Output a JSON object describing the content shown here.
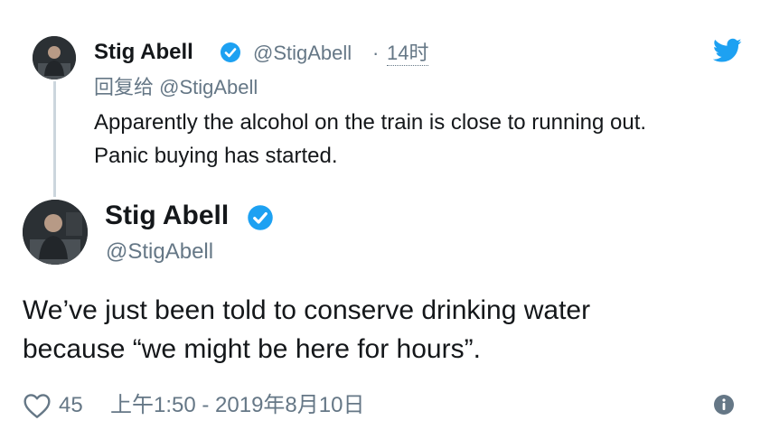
{
  "parent_tweet": {
    "name": "Stig Abell",
    "handle": "@StigAbell",
    "separator": "·",
    "time": "14时",
    "reply_to_prefix": "回复给",
    "reply_to_handle": "@StigAbell",
    "text_line1": "Apparently the alcohol on the train is close to running out.",
    "text_line2": "Panic buying has started."
  },
  "main_tweet": {
    "name": "Stig Abell",
    "handle": "@StigAbell",
    "text_line1": "We’ve just been told to conserve drinking water",
    "text_line2": "because “we might be here for hours”.",
    "likes": "45",
    "timestamp": "上午1:50 - 2019年8月10日"
  },
  "icons": {
    "brand": "twitter-bird-icon",
    "verified": "verified-badge-icon",
    "like": "heart-icon",
    "info": "info-icon"
  },
  "colors": {
    "brand_blue": "#1da1f2",
    "text": "#14171a",
    "muted": "#657786",
    "thread_line": "#ccd6dd"
  }
}
